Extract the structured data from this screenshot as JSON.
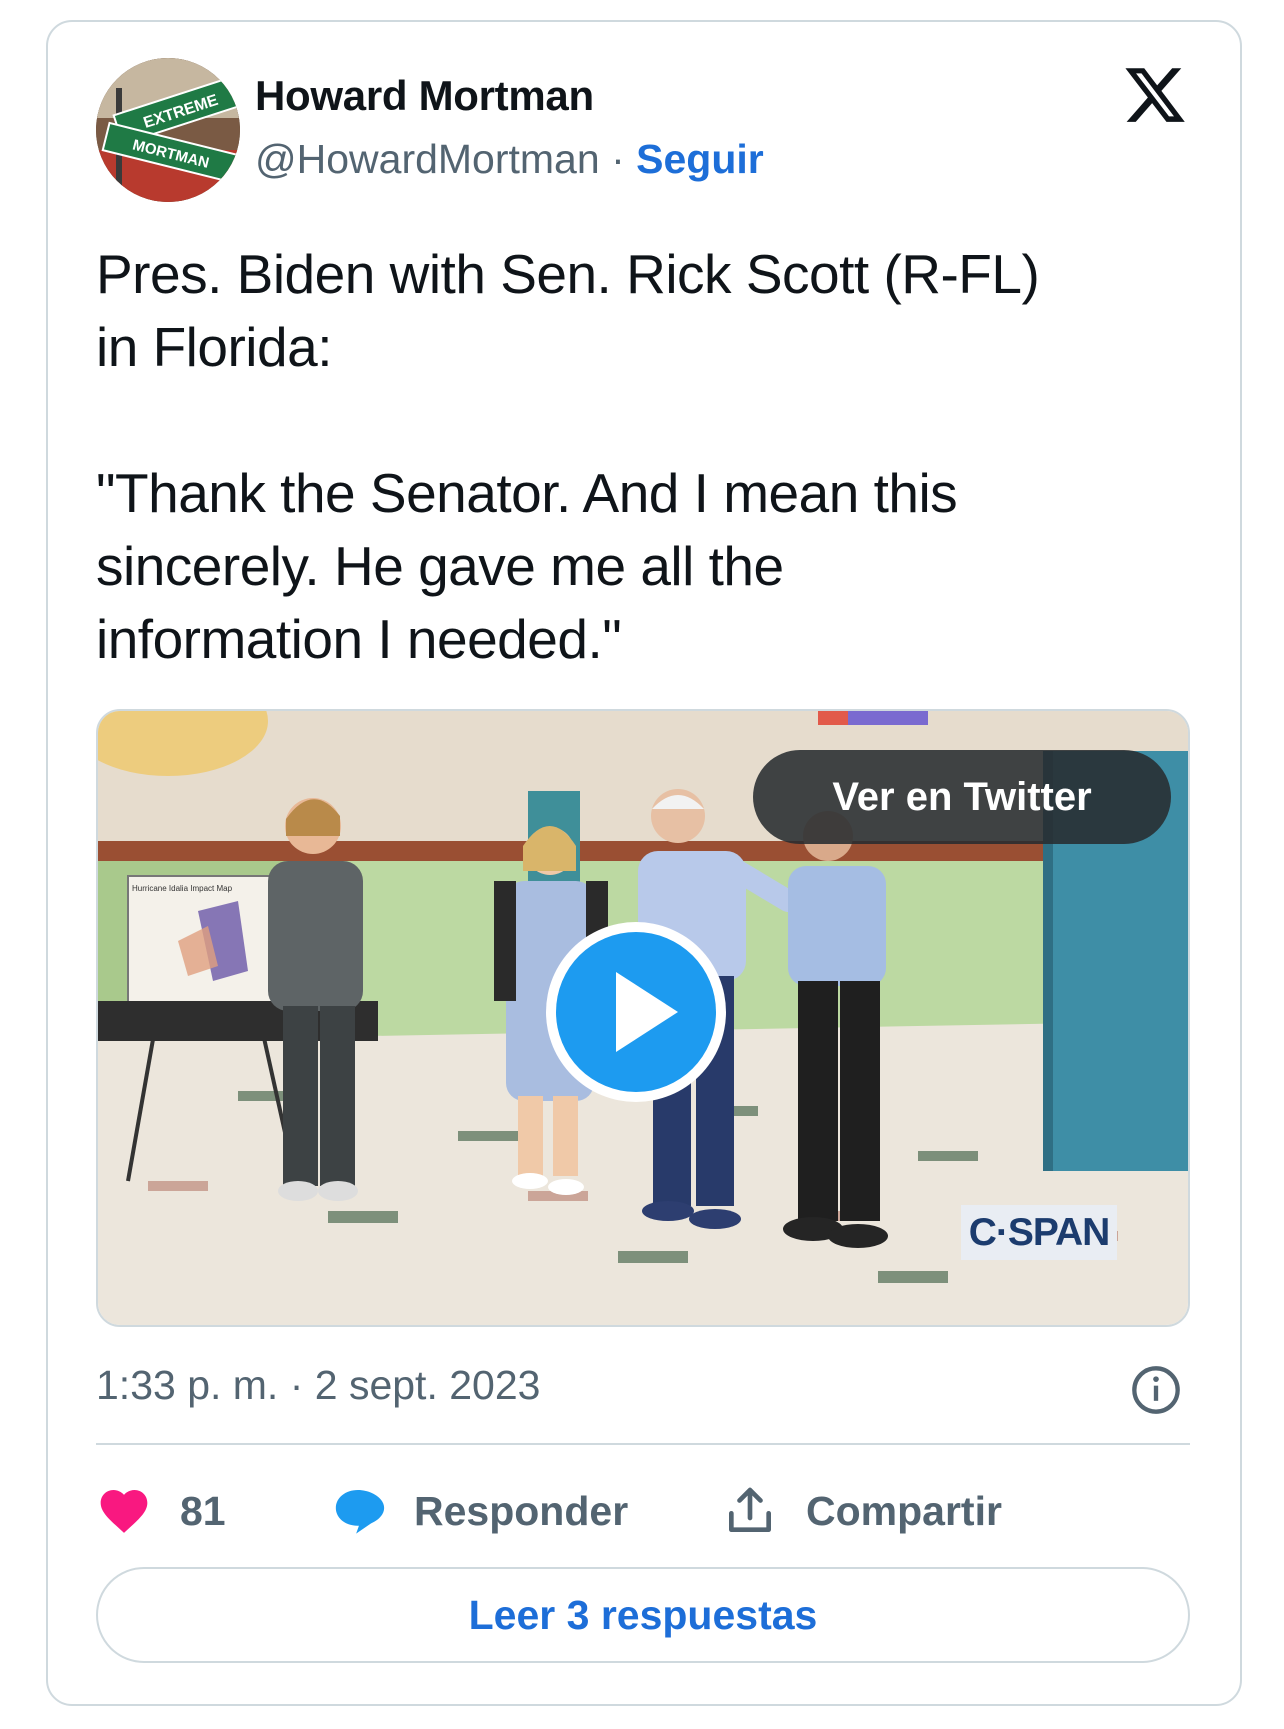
{
  "author": {
    "name": "Howard Mortman",
    "handle": "@HowardMortman",
    "separator": "·",
    "follow_label": "Seguir",
    "avatar_sign_top": "EXTREME",
    "avatar_sign_bottom": "MORTMAN"
  },
  "tweet": {
    "text": "Pres. Biden with Sen. Rick Scott (R-FL)\nin Florida:\n\n\"Thank the Senator. And I mean this\nsincerely. He gave me all the\ninformation I needed.\""
  },
  "media": {
    "view_on_twitter_label": "Ver en Twitter",
    "watermark": "C·SPAN",
    "easel_heading": "Hurricane Idalia Impact Map",
    "play_icon": "play-icon"
  },
  "meta": {
    "timestamp": "1:33 p. m. · 2 sept. 2023",
    "info_icon": "info-icon"
  },
  "actions": {
    "like_count": "81",
    "reply_label": "Responder",
    "share_label": "Compartir"
  },
  "read_replies_label": "Leer 3 respuestas",
  "colors": {
    "link_blue": "#1d6ed8",
    "play_blue": "#1d9bf0",
    "like_pink": "#f91880",
    "reply_blue": "#1d9bf0",
    "border": "#cfd9de",
    "muted_text": "#536471"
  }
}
